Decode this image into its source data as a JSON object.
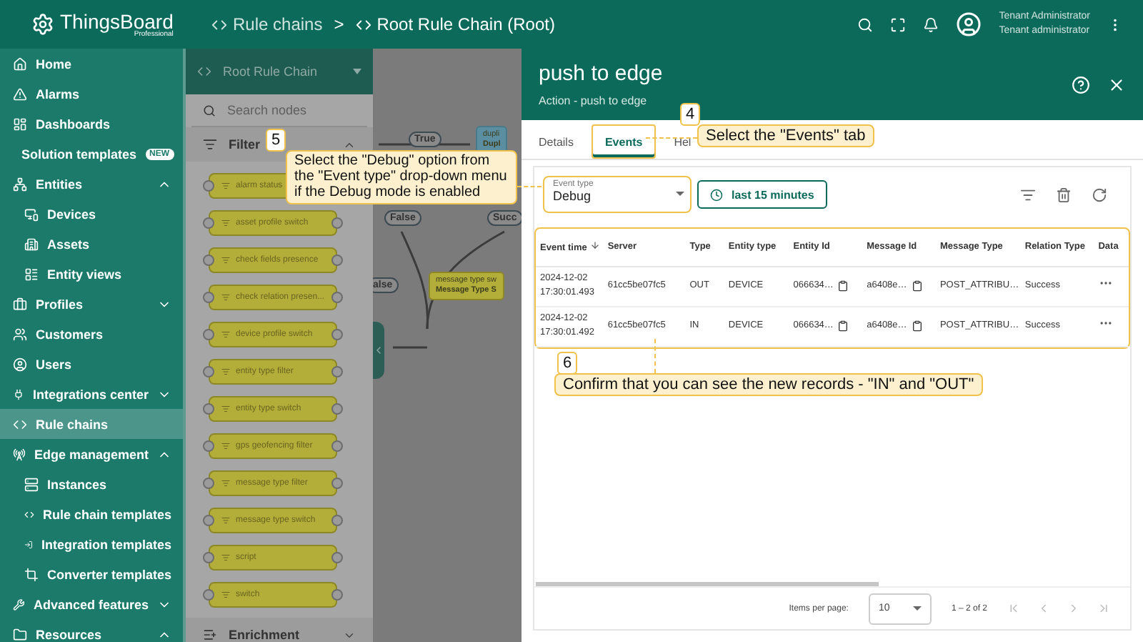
{
  "top_bar": {
    "logo": {
      "name": "ThingsBoard",
      "edition": "Professional"
    },
    "breadcrumbs": [
      "Rule chains",
      "Root Rule Chain (Root)"
    ],
    "separator": ">",
    "user": {
      "name": "Tenant Administrator",
      "role": "Tenant administrator"
    }
  },
  "sidebar": {
    "items": [
      {
        "label": "Home",
        "selected": false
      },
      {
        "label": "Alarms",
        "selected": false
      },
      {
        "label": "Dashboards",
        "selected": false
      },
      {
        "label": "Solution templates",
        "selected": false,
        "badge": "NEW"
      },
      {
        "label": "Entities",
        "selected": false,
        "expanded": true,
        "children": [
          {
            "label": "Devices",
            "selected": false
          },
          {
            "label": "Assets",
            "selected": false
          },
          {
            "label": "Entity views",
            "selected": false
          }
        ]
      },
      {
        "label": "Profiles",
        "selected": false,
        "expanded": false
      },
      {
        "label": "Customers",
        "selected": false
      },
      {
        "label": "Users",
        "selected": false
      },
      {
        "label": "Integrations center",
        "selected": false,
        "expanded": false
      },
      {
        "label": "Rule chains",
        "selected": true
      },
      {
        "label": "Edge management",
        "selected": false,
        "expanded": true,
        "children": [
          {
            "label": "Instances",
            "selected": false
          },
          {
            "label": "Rule chain templates",
            "selected": false
          },
          {
            "label": "Integration templates",
            "selected": false
          },
          {
            "label": "Converter templates",
            "selected": false
          }
        ]
      },
      {
        "label": "Advanced features",
        "selected": false,
        "expanded": false
      },
      {
        "label": "Resources",
        "selected": false,
        "expanded": true
      }
    ]
  },
  "node_library": {
    "title": "Root Rule Chain",
    "search": {
      "placeholder": "Search nodes"
    },
    "sections": [
      {
        "title": "Filter",
        "expanded": true,
        "nodes": [
          "alarm status",
          "asset profile switch",
          "check fields presence",
          "check relation presen...",
          "device profile switch",
          "entity type filter",
          "entity type switch",
          "gps geofencing filter",
          "message type filter",
          "message type switch",
          "script",
          "switch"
        ]
      },
      {
        "title": "Enrichment",
        "expanded": false
      }
    ]
  },
  "canvas": {
    "links": [
      "True",
      "False",
      "Succ",
      "alse"
    ],
    "nodes": [
      {
        "title": "dupli",
        "subtitle": "Dupl",
        "kind": "flow"
      },
      {
        "title": "message type sw",
        "subtitle": "Message Type S",
        "kind": "filter"
      }
    ]
  },
  "drawer": {
    "title": "push to edge",
    "subtitle": "Action - push to edge",
    "tabs": [
      {
        "label": "Details",
        "selected": false,
        "highlighted": false
      },
      {
        "label": "Events",
        "selected": true,
        "highlighted": true
      },
      {
        "label": "Hel",
        "selected": false,
        "highlighted": false
      }
    ],
    "event_type": {
      "label": "Event type",
      "value": "Debug",
      "highlighted": true
    },
    "time_button": "last 15 minutes",
    "table": {
      "highlighted": true,
      "columns": [
        "Event time",
        "Server",
        "Type",
        "Entity type",
        "Entity Id",
        "Message Id",
        "Message Type",
        "Relation Type",
        "Data"
      ],
      "rows": [
        {
          "event_time": "2024-12-02 17:30:01.493",
          "server": "61cc5be07fc5",
          "type": "OUT",
          "entity_type": "DEVICE",
          "entity_id": "066634…",
          "message_id": "a6408e…",
          "message_type": "POST_ATTRIBU…",
          "relation_type": "Success"
        },
        {
          "event_time": "2024-12-02 17:30:01.492",
          "server": "61cc5be07fc5",
          "type": "IN",
          "entity_type": "DEVICE",
          "entity_id": "066634…",
          "message_id": "a6408e…",
          "message_type": "POST_ATTRIBU…",
          "relation_type": "Success"
        }
      ]
    },
    "paginator": {
      "label": "Items per page:",
      "page_size": "10",
      "range": "1 – 2 of 2"
    }
  },
  "callouts": [
    {
      "number": "4",
      "text": "Select the \"Events\" tab"
    },
    {
      "number": "5",
      "text": "Select the \"Debug\" option from the \"Event type\" drop-down menu if the Debug mode is enabled"
    },
    {
      "number": "6",
      "text": "Confirm that you can see the new records - \"IN\" and \"OUT\""
    }
  ]
}
